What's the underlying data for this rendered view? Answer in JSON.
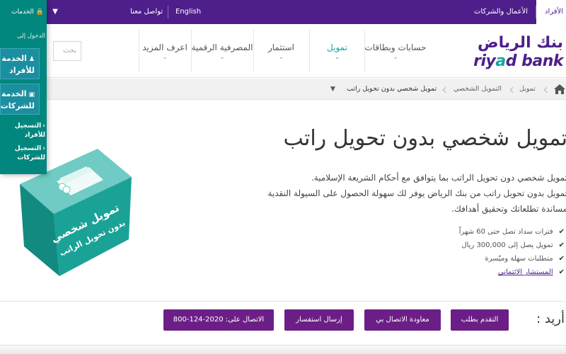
{
  "topbar": {
    "individuals": "الأفراد",
    "business": "الأعمال والشركات",
    "language": "English",
    "contact": "تواصل معنا",
    "services_menu": "الخدمات المصرفية"
  },
  "logo": {
    "arabic": "بنك الرياض",
    "english_part1": "riy",
    "english_a": "a",
    "english_part2": "d bank"
  },
  "nav": {
    "items": [
      {
        "label": "حسابات وبطاقات",
        "active": false
      },
      {
        "label": "تمويل",
        "active": true
      },
      {
        "label": "استثمار",
        "active": false
      },
      {
        "label": "المصرفية الرقمية",
        "active": false
      },
      {
        "label": "اعرف المزيد",
        "active": false
      }
    ],
    "search_placeholder": "بحث"
  },
  "breadcrumb": {
    "items": [
      "تمويل",
      "التمويل الشخصي",
      "تمويل شخصي بدون تحويل راتب"
    ],
    "dropdown_icon": "triangle-down"
  },
  "hero": {
    "title": "تمويل شخصي بدون تحويل راتب",
    "body_lines": [
      "تمويل شخصي دون تحويل الراتب بما يتوافق مع أحكام الشريعة الإسلامية.",
      "تمويل بدون تحويل راتب من بنك الرياض يوفر لك سهولة الحصول على السيولة النقدية",
      "مساندة تطلعاتك وتحقيق أهدافك."
    ],
    "bullets": [
      "فترات سداد تصل حتى 60 شهراً",
      "تمويل يصل إلى 300,000 ريال",
      "متطلبات سهلة وميّسرة"
    ],
    "bullet_link": "المستشار الائتماني",
    "cube_text_line1": "تمويل شخصي",
    "cube_text_line2": "بدون تحويل الراتب"
  },
  "sidepanel": {
    "header": "الخدمات",
    "login_label": "الدخول إلى",
    "btn_individuals_line1": "الخدمة",
    "btn_individuals_line2": "للأفراد",
    "btn_business_line1": "الخدمة",
    "btn_business_line2": "للشركات",
    "register_individuals_line1": "التسجيل",
    "register_individuals_line2": "للأفراد",
    "register_business_line1": "التسجيل",
    "register_business_line2": "للشركات"
  },
  "cta": {
    "label": "أريد :",
    "apply": "التقدم بطلب",
    "callback": "معاودة الاتصال بي",
    "inquiry": "إرسال استفسار",
    "call_label": "الاتصال على:",
    "call_number": "800-124-2020"
  },
  "colors": {
    "brand_purple": "#4e1f8a",
    "brand_teal": "#1aa59b",
    "cta_purple": "#6b1f86",
    "sidebar_teal": "#02877e"
  }
}
